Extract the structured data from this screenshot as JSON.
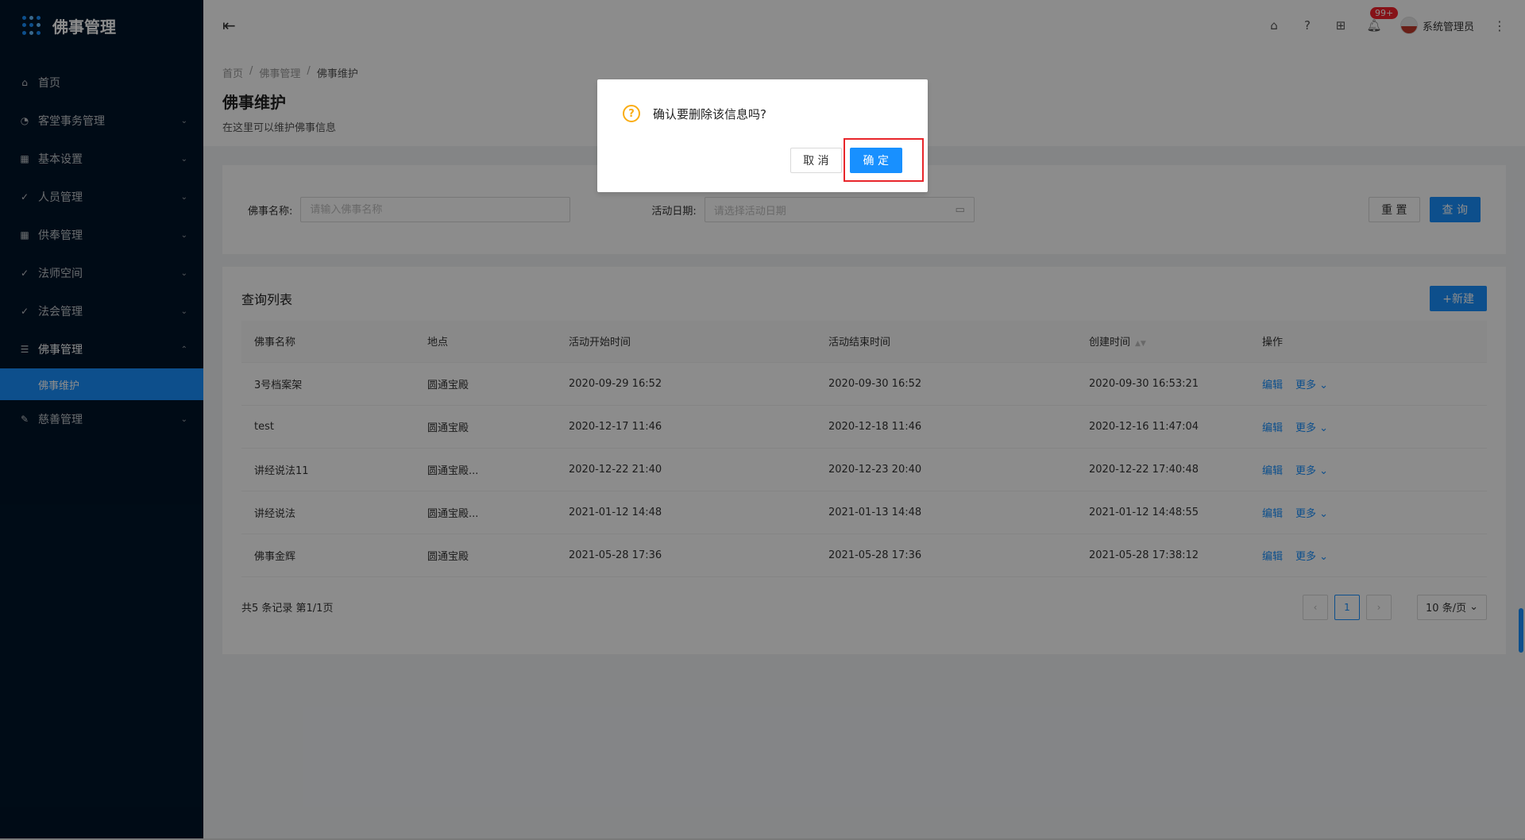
{
  "app": {
    "title": "佛事管理"
  },
  "sidebar": {
    "items": [
      {
        "label": "首页",
        "icon": "home-icon",
        "arrow": ""
      },
      {
        "label": "客堂事务管理",
        "icon": "dashboard-icon",
        "arrow": "⌄"
      },
      {
        "label": "基本设置",
        "icon": "table-icon",
        "arrow": "⌄"
      },
      {
        "label": "人员管理",
        "icon": "check-circle-icon",
        "arrow": "⌄"
      },
      {
        "label": "供奉管理",
        "icon": "table-icon",
        "arrow": "⌄"
      },
      {
        "label": "法师空间",
        "icon": "check-circle-icon",
        "arrow": "⌄"
      },
      {
        "label": "法会管理",
        "icon": "check-circle-icon",
        "arrow": "⌄"
      },
      {
        "label": "佛事管理",
        "icon": "profile-icon",
        "arrow": "⌃"
      }
    ],
    "active_sub": "佛事维护",
    "last_item": {
      "label": "慈善管理",
      "icon": "form-icon",
      "arrow": "⌄"
    }
  },
  "header": {
    "notify_count": "99+",
    "user_name": "系统管理员"
  },
  "breadcrumb": [
    "首页",
    "佛事管理",
    "佛事维护"
  ],
  "page": {
    "title": "佛事维护",
    "desc": "在这里可以维护佛事信息"
  },
  "filter": {
    "name_label": "佛事名称:",
    "name_placeholder": "请输入佛事名称",
    "date_label": "活动日期:",
    "date_placeholder": "请选择活动日期",
    "reset_label": "重 置",
    "query_label": "查 询"
  },
  "list": {
    "title": "查询列表",
    "new_label": "+新建",
    "columns": [
      "佛事名称",
      "地点",
      "活动开始时间",
      "活动结束时间",
      "创建时间",
      "操作"
    ],
    "rows": [
      {
        "name": "3号档案架",
        "place": "圆通宝殿",
        "start": "2020-09-29 16:52",
        "end": "2020-09-30 16:52",
        "created": "2020-09-30 16:53:21"
      },
      {
        "name": "test",
        "place": "圆通宝殿",
        "start": "2020-12-17 11:46",
        "end": "2020-12-18 11:46",
        "created": "2020-12-16 11:47:04"
      },
      {
        "name": "讲经说法11",
        "place": "圆通宝殿...",
        "start": "2020-12-22 21:40",
        "end": "2020-12-23 20:40",
        "created": "2020-12-22 17:40:48"
      },
      {
        "name": "讲经说法",
        "place": "圆通宝殿...",
        "start": "2021-01-12 14:48",
        "end": "2021-01-13 14:48",
        "created": "2021-01-12 14:48:55"
      },
      {
        "name": "佛事金辉",
        "place": "圆通宝殿",
        "start": "2021-05-28 17:36",
        "end": "2021-05-28 17:36",
        "created": "2021-05-28 17:38:12"
      }
    ],
    "edit_label": "编辑",
    "more_label": "更多",
    "total_text": "共5 条记录 第1/1页",
    "current_page": "1",
    "page_size": "10 条/页"
  },
  "modal": {
    "message": "确认要删除该信息吗?",
    "cancel_label": "取 消",
    "ok_label": "确 定"
  },
  "colors": {
    "primary": "#1890ff",
    "sidebar": "#001529",
    "warning": "#faad14",
    "highlight": "#e8262b"
  }
}
